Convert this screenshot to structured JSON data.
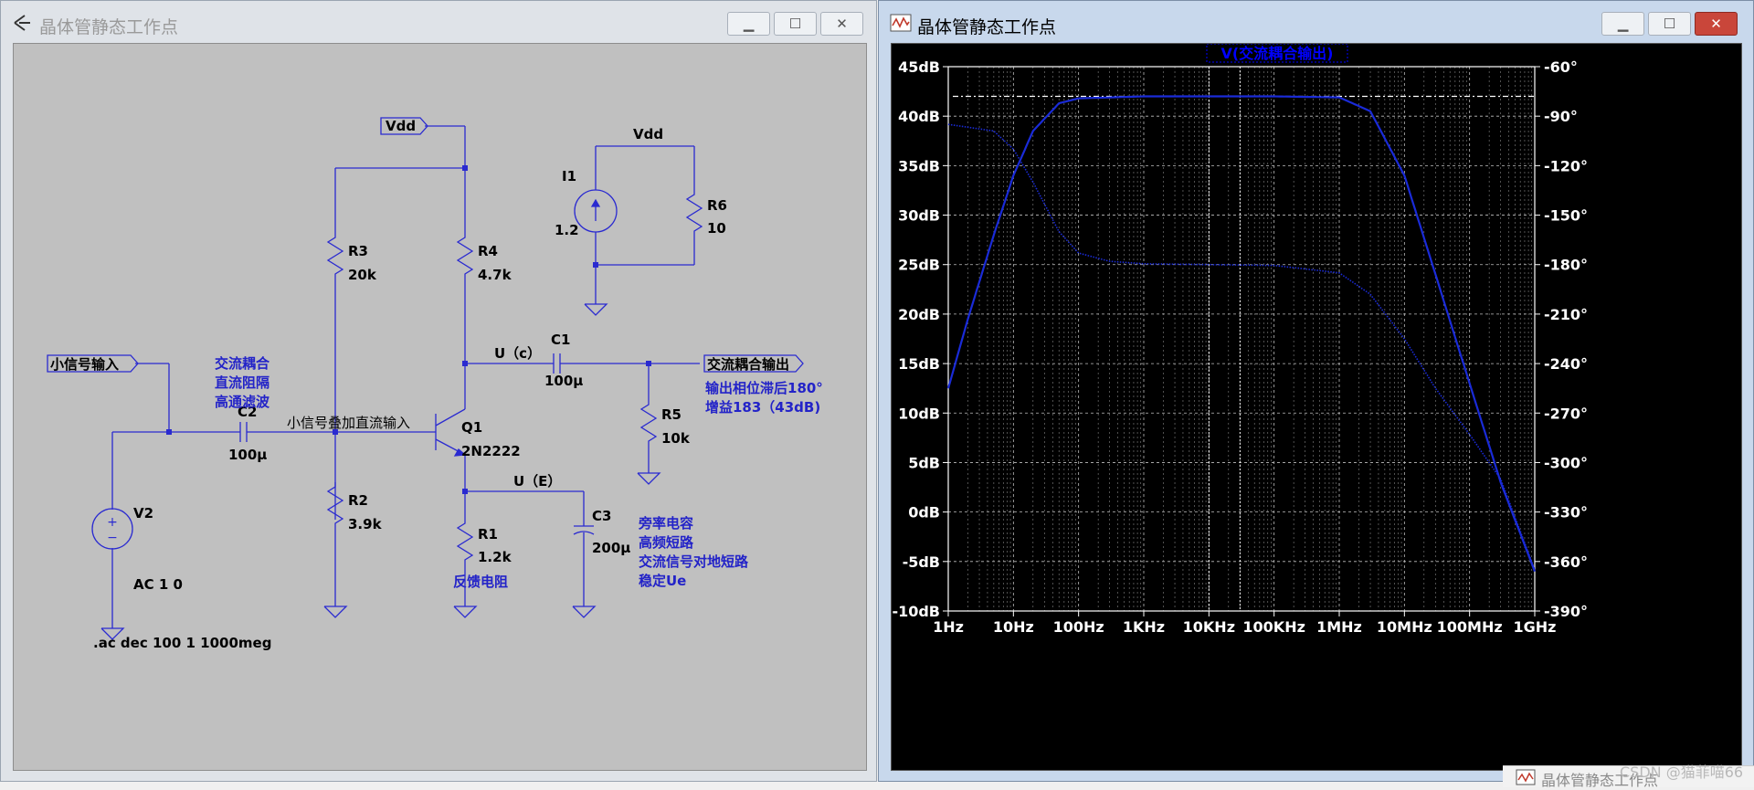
{
  "windows": {
    "schematic": {
      "title": "晶体管静态工作点",
      "minimize": "▁",
      "maximize": "☐",
      "close": "✕"
    },
    "plot": {
      "title": "晶体管静态工作点",
      "minimize": "▁",
      "maximize": "☐",
      "close": "✕"
    }
  },
  "schematic": {
    "net_labels": {
      "vdd_top": "Vdd",
      "vdd_aux": "Vdd",
      "input": "小信号输入",
      "output": "交流耦合输出",
      "base_note": "小信号叠加直流输入"
    },
    "components": {
      "R3": {
        "name": "R3",
        "value": "20k"
      },
      "R4": {
        "name": "R4",
        "value": "4.7k"
      },
      "R2": {
        "name": "R2",
        "value": "3.9k"
      },
      "R1": {
        "name": "R1",
        "value": "1.2k"
      },
      "R5": {
        "name": "R5",
        "value": "10k"
      },
      "R6": {
        "name": "R6",
        "value": "10"
      },
      "C1": {
        "name": "C1",
        "value": "100µ"
      },
      "C2": {
        "name": "C2",
        "value": "100µ"
      },
      "C3": {
        "name": "C3",
        "value": "200µ"
      },
      "Q1": {
        "name": "Q1",
        "value": "2N2222"
      },
      "I1": {
        "name": "I1",
        "value": "1.2"
      },
      "V2": {
        "name": "V2",
        "value": "AC 1 0"
      }
    },
    "node_labels": {
      "uc": "U（c）",
      "ue": "U（E）"
    },
    "notes": {
      "c2_1": "交流耦合",
      "c2_2": "直流阻隔",
      "c2_3": "高通滤波",
      "out_1": "输出相位滞后180°",
      "out_2": "增益183（43dB)",
      "r1": "反馈电阻",
      "c3_1": "旁率电容",
      "c3_2": "高频短路",
      "c3_3": "交流信号对地短路",
      "c3_4": "稳定Ue"
    },
    "directive": ".ac dec 100 1 1000meg"
  },
  "chart_data": {
    "type": "line",
    "title": "V(交流耦合输出)",
    "x_scale": "log",
    "x_ticks": [
      "1Hz",
      "10Hz",
      "100Hz",
      "1KHz",
      "10KHz",
      "100KHz",
      "1MHz",
      "10MHz",
      "100MHz",
      "1GHz"
    ],
    "y_left_ticks": [
      "45dB",
      "40dB",
      "35dB",
      "30dB",
      "25dB",
      "20dB",
      "15dB",
      "10dB",
      "5dB",
      "0dB",
      "-5dB",
      "-10dB"
    ],
    "y_right_ticks": [
      "-60°",
      "-90°",
      "-120°",
      "-150°",
      "-180°",
      "-210°",
      "-240°",
      "-270°",
      "-300°",
      "-330°",
      "-360°",
      "-390°"
    ],
    "y_left_range": [
      -10,
      45
    ],
    "y_right_range": [
      -390,
      -60
    ],
    "cursor_level_db": 42,
    "series": [
      {
        "style": "solid",
        "axis": "left",
        "points": [
          [
            1,
            12.5
          ],
          [
            2,
            19.5
          ],
          [
            5,
            28
          ],
          [
            10,
            34
          ],
          [
            20,
            38.5
          ],
          [
            50,
            41.3
          ],
          [
            100,
            41.8
          ],
          [
            1000,
            42
          ],
          [
            100000,
            42
          ],
          [
            1000000,
            41.9
          ],
          [
            3000000,
            40.5
          ],
          [
            10000000,
            34
          ],
          [
            30000000,
            24
          ],
          [
            100000000,
            13
          ],
          [
            300000000,
            3
          ],
          [
            1000000000,
            -6
          ]
        ]
      },
      {
        "style": "dotted",
        "axis": "right",
        "points": [
          [
            1,
            -95
          ],
          [
            5,
            -99
          ],
          [
            10,
            -110
          ],
          [
            20,
            -130
          ],
          [
            50,
            -160
          ],
          [
            100,
            -173
          ],
          [
            300,
            -178
          ],
          [
            1000,
            -179.5
          ],
          [
            10000,
            -180
          ],
          [
            100000,
            -180.5
          ],
          [
            1000000,
            -185
          ],
          [
            3000000,
            -198
          ],
          [
            10000000,
            -225
          ],
          [
            30000000,
            -255
          ],
          [
            100000000,
            -283
          ],
          [
            300000000,
            -310
          ],
          [
            1000000000,
            -365
          ]
        ]
      }
    ],
    "colors": {
      "curve": "#1a2bd8",
      "title_box": "#0000ff",
      "grid": "#bfbfbf",
      "axis": "#ffffff"
    }
  },
  "watermark": "CSDN @猫菲喵66",
  "taskbar": {
    "title": "晶体管静态工作点"
  }
}
